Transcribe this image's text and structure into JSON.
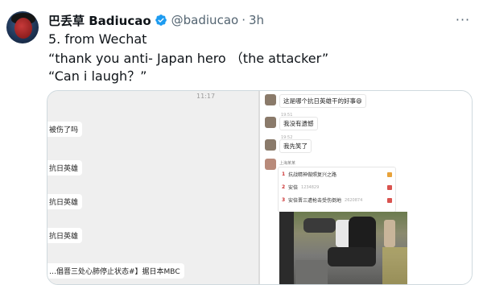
{
  "user": {
    "display_name": "巴丢草 Badiucao",
    "handle": "@badiucao",
    "separator": "·",
    "time": "3h",
    "verified_color": "#1d9bf0"
  },
  "tweet_lines": [
    "5. from Wechat",
    "“thank you anti- Japan hero （the attacker”",
    "“Can i laugh？”"
  ],
  "more_menu": "···",
  "screenshot": {
    "left_status_time": "11:17",
    "left_messages": [
      "被伤了吗",
      "抗日英雄",
      "抗日英雄",
      "抗日英雄",
      "…倡晋三处心肺停止状态#】据日本MBC"
    ],
    "right_chat": {
      "first_message": "这是哪个抗日英雄干的好事😄",
      "messages": [
        {
          "meta": "19:51",
          "text": "我没有遗憾"
        },
        {
          "meta": "19:52",
          "text": "我先笑了"
        }
      ],
      "card_name": "上海某某",
      "card_rows": [
        {
          "num": "1",
          "text": "抗战精神做照复兴之路",
          "extra": "",
          "tag_color": "#e8a23a"
        },
        {
          "num": "2",
          "text": "安倍",
          "extra": "1234829",
          "tag_color": "#d9534f"
        },
        {
          "num": "3",
          "text": "安倍晋三遭枪击受伤倒地",
          "extra": "2620874",
          "tag_color": "#d9534f"
        }
      ]
    }
  }
}
